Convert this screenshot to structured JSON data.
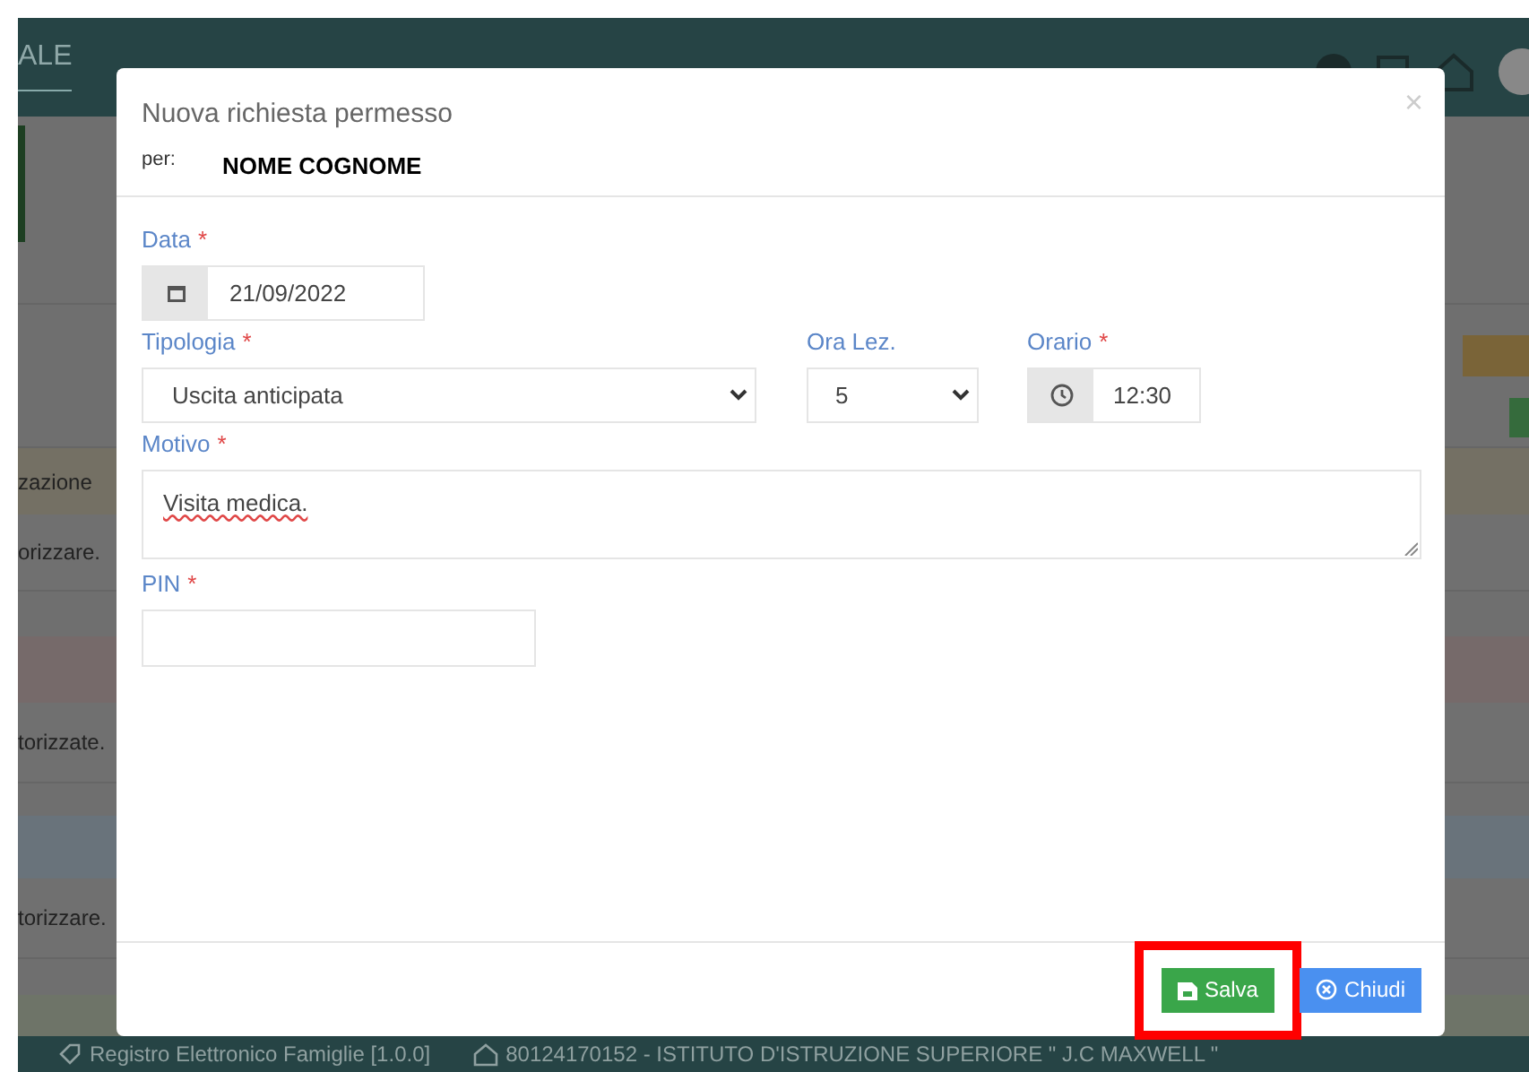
{
  "app": {
    "brand": "ALE",
    "row_texts": [
      "zazione",
      "orizzare.",
      "torizzate.",
      "torizzare."
    ],
    "footer": {
      "version": "Registro Elettronico Famiglie [1.0.0]",
      "school": "80124170152 - ISTITUTO D'ISTRUZIONE SUPERIORE \" J.C MAXWELL \""
    }
  },
  "modal": {
    "title": "Nuova richiesta permesso",
    "for_label": "per:",
    "for_name": "NOME COGNOME",
    "close": "×",
    "fields": {
      "data": {
        "label": "Data",
        "required_mark": "*",
        "value": "21/09/2022"
      },
      "tipologia": {
        "label": "Tipologia",
        "required_mark": "*",
        "value": "Uscita anticipata"
      },
      "ora": {
        "label": "Ora Lez.",
        "value": "5"
      },
      "orario": {
        "label": "Orario",
        "required_mark": "*",
        "value": "12:30"
      },
      "motivo": {
        "label": "Motivo",
        "required_mark": "*",
        "value": "Visita medica."
      },
      "pin": {
        "label": "PIN",
        "required_mark": "*"
      }
    },
    "buttons": [
      {
        "kind": "save",
        "label": "Salva",
        "highlighted": true
      },
      {
        "kind": "close",
        "label": "Chiudi",
        "highlighted": false
      }
    ]
  }
}
